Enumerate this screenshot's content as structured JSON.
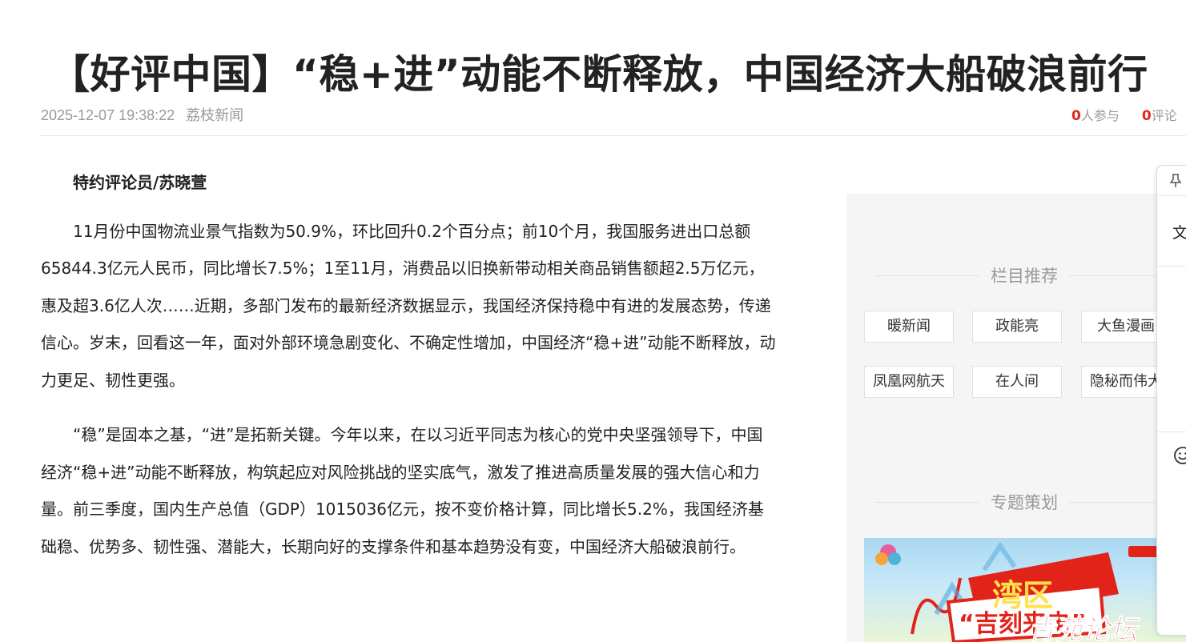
{
  "article": {
    "title": "【好评中国】“稳+进”动能不断释放，中国经济大船破浪前行",
    "datetime": "2025-12-07 19:38:22",
    "source": "荔枝新闻",
    "participants_count": "0",
    "participants_label": "人参与",
    "comments_count": "0",
    "comments_label": "评论",
    "author": "特约评论员/苏晓萱",
    "paragraphs": [
      "11月份中国物流业景气指数为50.9%，环比回升0.2个百分点；前10个月，我国服务进出口总额65844.3亿元人民币，同比增长7.5%；1至11月，消费品以旧换新带动相关商品销售额超2.5万亿元，惠及超3.6亿人次……近期，多部门发布的最新经济数据显示，我国经济保持稳中有进的发展态势，传递信心。岁末，回看这一年，面对外部环境急剧变化、不确定性增加，中国经济“稳+进”动能不断释放，动力更足、韧性更强。",
      "“稳”是固本之基，“进”是拓新关键。今年以来，在以习近平同志为核心的党中央坚强领导下，中国经济“稳+进”动能不断释放，构筑起应对风险挑战的坚实底气，激发了推进高质量发展的强大信心和力量。前三季度，国内生产总值（GDP）1015036亿元，按不变价格计算，同比增长5.2%，我国经济基础稳、优势多、韧性强、潜能大，长期向好的支撑条件和基本趋势没有变，中国经济大船破浪前行。"
    ]
  },
  "sidebar": {
    "column_title": "栏目推荐",
    "tags": [
      "暖新闻",
      "政能亮",
      "大鱼漫画",
      "凤凰网航天",
      "在人间",
      "隐秘而伟大"
    ],
    "special_title": "专题策划",
    "banner_text_1": "湾区",
    "banner_text_2": "“吉刻来电”",
    "watermark": "青苑论坛"
  },
  "float_panel": {
    "pin_icon": "pin-icon",
    "text_glyph": "文",
    "emoji_icon": "smile-icon"
  },
  "colors": {
    "accent_red": "#e2231a",
    "meta_gray": "#999999",
    "sidebar_bg": "#f5f5f5"
  }
}
